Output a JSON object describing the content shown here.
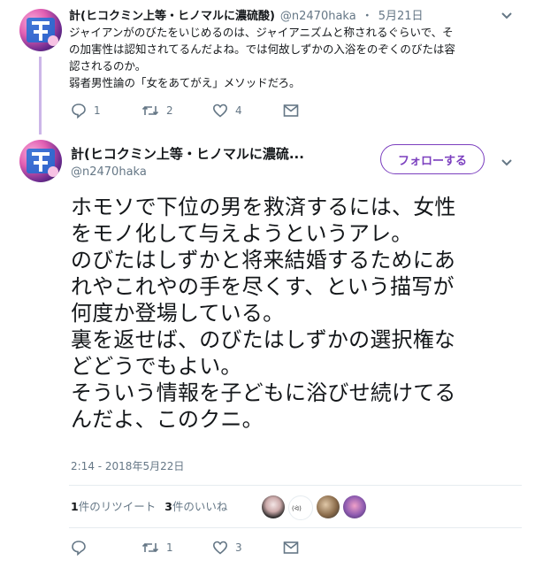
{
  "reply_tweet": {
    "name": "計(ヒコクミン上等・ヒノマルに濃硫酸)",
    "handle": "@n2470haka",
    "separator": "・",
    "date": "5月21日",
    "lines": [
      "ジャイアンがのびたをいじめるのは、ジャイアニズムと称されるぐらいで、そ",
      "の加害性は認知されてるんだよね。では何故しずかの入浴をのぞくのびたは容",
      "認されるのか。",
      "弱者男性論の「女をあてがえ」メソッドだろ。"
    ],
    "actions": {
      "replies": "1",
      "retweets": "2",
      "likes": "4"
    }
  },
  "main_tweet": {
    "name": "計(ヒコクミン上等・ヒノマルに濃硫...",
    "handle": "@n2470haka",
    "follow_label": "フォローする",
    "lines": [
      "ホモソで下位の男を救済するには、女性",
      "をモノ化して与えようというアレ。",
      "のびたはしずかと将来結婚するためにあ",
      "れやこれやの手を尽くす、という描写が",
      "何度か登場している。",
      "裏を返せば、のびたはしずかの選択権な",
      "どどうでもよい。",
      "そういう情報を子どもに浴びせ続けてる",
      "んだよ、このクニ。"
    ],
    "timestamp": "2:14 - 2018年5月22日",
    "stats": {
      "retweets_count": "1",
      "retweets_label": "件のリツイート",
      "likes_count": "3",
      "likes_label": "件のいいね"
    },
    "actions": {
      "replies": "",
      "retweets": "1",
      "likes": "3"
    }
  },
  "colors": {
    "accent": "#7b3fbf",
    "thread_line": "#ccb6e8",
    "muted": "#657786"
  }
}
